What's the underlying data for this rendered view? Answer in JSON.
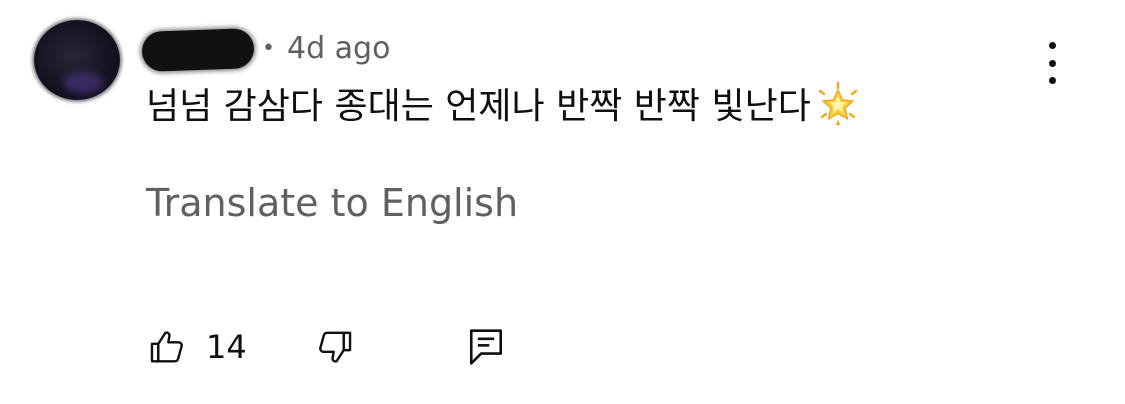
{
  "comment": {
    "timestamp": "4d ago",
    "separator": "•",
    "text": "넘넘 감삼다 종대는 언제나 반짝 반짝 빛난다",
    "emoji": "glowing-star-icon",
    "translate_label": "Translate to English"
  },
  "actions": {
    "like_count": "14",
    "like_icon": "thumbs-up-icon",
    "dislike_icon": "thumbs-down-icon",
    "reply_icon": "reply-comment-icon"
  },
  "menu": {
    "icon": "more-vertical-icon"
  },
  "colors": {
    "primary_text": "#0f0f0f",
    "secondary_text": "#606060"
  }
}
